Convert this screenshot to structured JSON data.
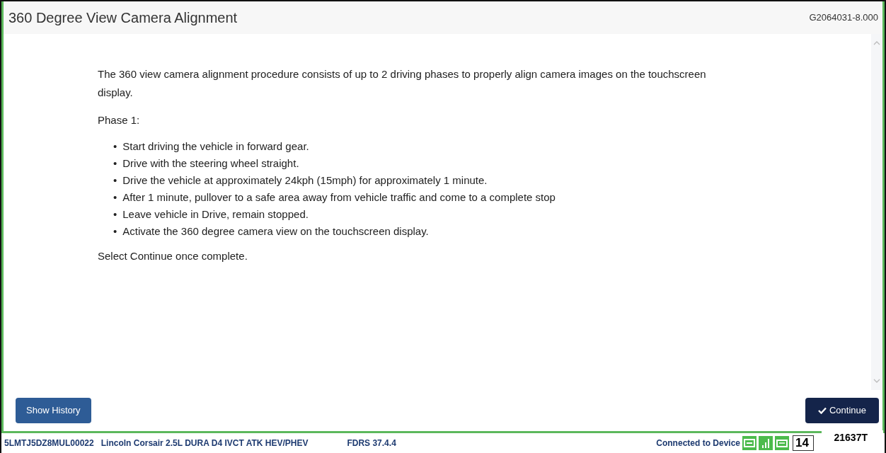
{
  "header": {
    "title": "360 Degree View Camera Alignment",
    "code": "G2064031-8.000"
  },
  "content": {
    "intro": "The 360 view camera alignment procedure consists of up to 2 driving phases to properly align camera images on the touchscreen display.",
    "phase_label": "Phase 1:",
    "steps": [
      {
        "bullet": "•",
        "text": "Start driving the vehicle in forward gear."
      },
      {
        "bullet": "•",
        "text": "Drive with the steering wheel straight."
      },
      {
        "bullet": "•",
        "text": "Drive the vehicle at approximately 24kph (15mph) for approximately 1 minute."
      },
      {
        "bullet": "•",
        "text": "After 1 minute, pullover to a safe area away from vehicle traffic and come to a complete stop"
      },
      {
        "bullet": "•",
        "text": "Leave vehicle in Drive, remain stopped."
      },
      {
        "bullet": "•",
        "text": "Activate the 360 degree camera view on the touchscreen display."
      }
    ],
    "closing": "Select Continue once complete."
  },
  "buttons": {
    "history": "Show History",
    "continue": "Continue"
  },
  "status_bar": {
    "vin": "5LMTJ5DZ8MUL00022",
    "vehicle": "Lincoln Corsair 2.5L DURA D4 IVCT ATK HEV/PHEV",
    "version": "FDRS 37.4.4",
    "connection": "Connected to Device",
    "field_value": "14"
  },
  "figure_label": "21637T"
}
